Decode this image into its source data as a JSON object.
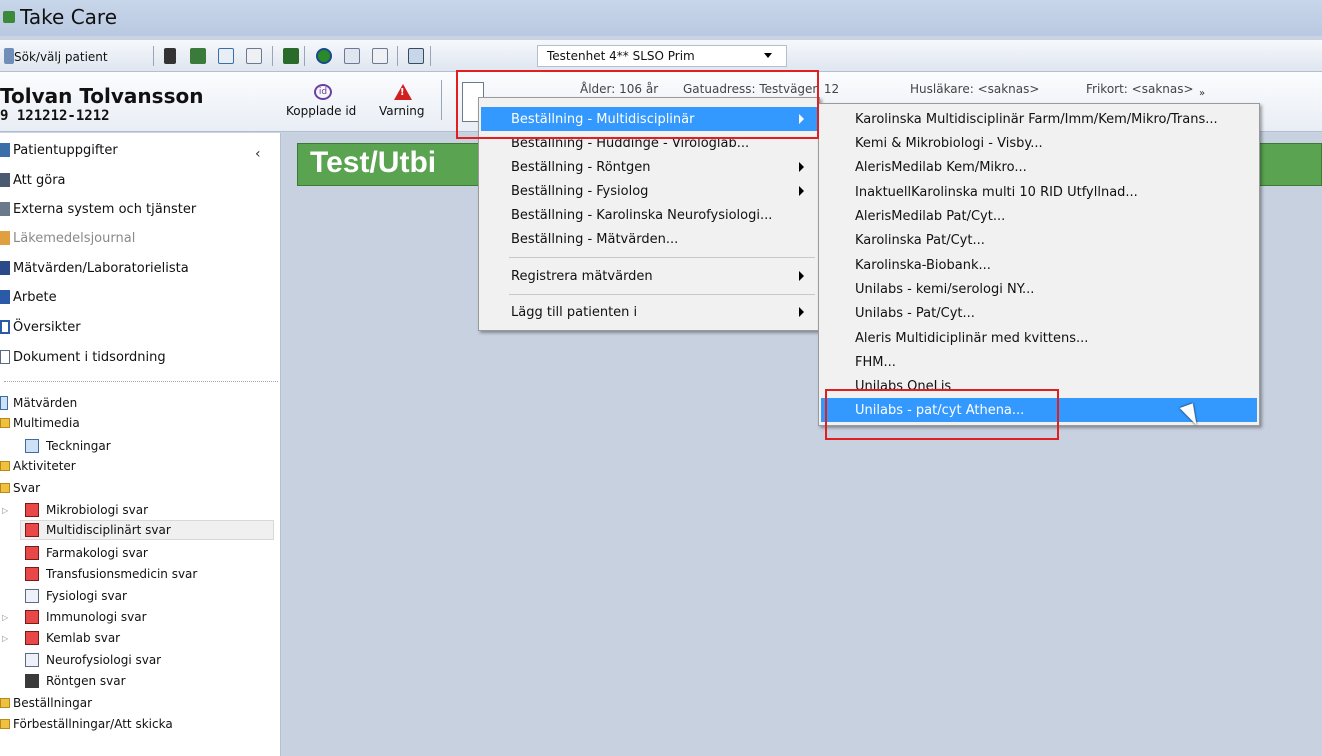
{
  "window": {
    "title": "Take Care"
  },
  "toolbar": {
    "search_patient_label": "Sök/välj patient",
    "unit_select_value": "Testenhet 4** SLSO Prim"
  },
  "patient": {
    "name": "Tolvan Tolvansson",
    "personnummer": "9 121212-1212",
    "linked_ids_label": "Kopplade id",
    "warning_label": "Varning",
    "age_label": "Ålder: 106 år",
    "address_label": "Gatuadress: Testvägen 12",
    "gp_label": "Husläkare: <saknas>",
    "frikort_label": "Frikort: <saknas>"
  },
  "sidebar": {
    "nav": [
      {
        "label": "Patientuppgifter",
        "disabled": false
      },
      {
        "label": "Att göra",
        "disabled": false
      },
      {
        "label": "Externa system och tjänster",
        "disabled": false
      },
      {
        "label": "Läkemedelsjournal",
        "disabled": true
      },
      {
        "label": "Mätvärden/Laboratorielista",
        "disabled": false
      },
      {
        "label": "Arbete",
        "disabled": false
      },
      {
        "label": "Översikter",
        "disabled": false
      },
      {
        "label": "Dokument i tidsordning",
        "disabled": false
      }
    ],
    "tree": [
      {
        "label": "Mätvärden"
      },
      {
        "label": "Multimedia"
      },
      {
        "label": "Teckningar"
      },
      {
        "label": "Aktiviteter"
      },
      {
        "label": "Svar"
      },
      {
        "label": "Mikrobiologi svar"
      },
      {
        "label": "Multidisciplinärt svar"
      },
      {
        "label": "Farmakologi svar"
      },
      {
        "label": "Transfusionsmedicin svar"
      },
      {
        "label": "Fysiologi svar"
      },
      {
        "label": "Immunologi svar"
      },
      {
        "label": "Kemlab svar"
      },
      {
        "label": "Neurofysiologi svar"
      },
      {
        "label": "Röntgen svar"
      },
      {
        "label": "Beställningar"
      },
      {
        "label": "Förbeställningar/Att skicka"
      }
    ]
  },
  "content": {
    "banner_text": "Test/Utbi"
  },
  "context_menu": {
    "items": [
      {
        "label": "Beställning - Multidisciplinär",
        "submenu": true,
        "highlighted": true
      },
      {
        "label": "Beställning - Huddinge - Virologlab...",
        "submenu": false
      },
      {
        "label": "Beställning - Röntgen",
        "submenu": true
      },
      {
        "label": "Beställning - Fysiolog",
        "submenu": true
      },
      {
        "label": "Beställning - Karolinska Neurofysiologi...",
        "submenu": false
      },
      {
        "label": "Beställning - Mätvärden...",
        "submenu": false
      },
      {
        "label": "Registrera mätvärden",
        "submenu": true
      },
      {
        "label": "Lägg till patienten i",
        "submenu": true
      }
    ]
  },
  "submenu": {
    "items": [
      {
        "label": "Karolinska Multidisciplinär Farm/Imm/Kem/Mikro/Trans..."
      },
      {
        "label": "Kemi & Mikrobiologi - Visby..."
      },
      {
        "label": "AlerisMedilab Kem/Mikro..."
      },
      {
        "label": "InaktuellKarolinska multi 10 RID Utfyllnad..."
      },
      {
        "label": "AlerisMedilab Pat/Cyt..."
      },
      {
        "label": "Karolinska Pat/Cyt..."
      },
      {
        "label": "Karolinska-Biobank..."
      },
      {
        "label": "Unilabs - kemi/serologi NY..."
      },
      {
        "label": "Unilabs - Pat/Cyt..."
      },
      {
        "label": "Aleris Multidiciplinär med kvittens..."
      },
      {
        "label": "FHM..."
      },
      {
        "label": "Unilabs OneLis"
      },
      {
        "label": "Unilabs - pat/cyt Athena...",
        "highlighted": true
      }
    ]
  },
  "colors": {
    "menu_highlight": "#3399ff",
    "annotation_red": "#e02020",
    "banner_green": "#5aa350"
  }
}
